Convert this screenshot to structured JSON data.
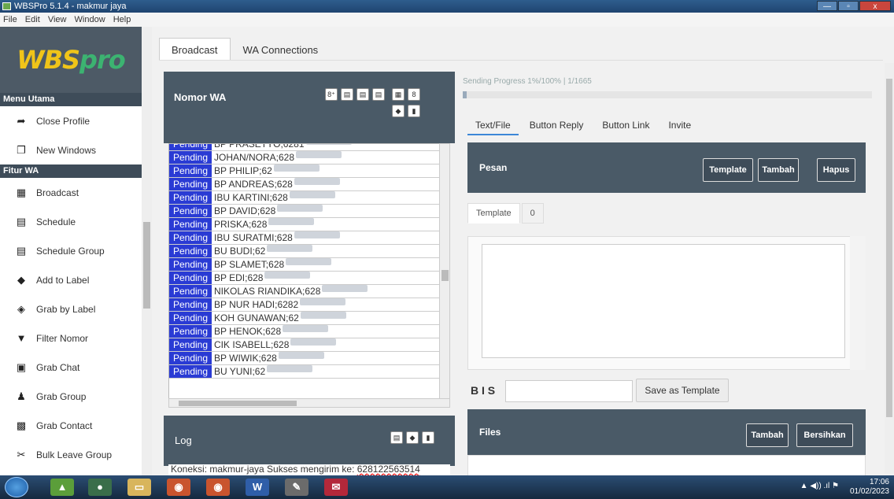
{
  "window": {
    "title": "WBSPro 5.1.4 - makmur jaya",
    "buttons": [
      "—",
      "▫",
      "x"
    ]
  },
  "menu": [
    "File",
    "Edit",
    "View",
    "Window",
    "Help"
  ],
  "logo": {
    "main": "WBS",
    "accent": "pro"
  },
  "sidebar": {
    "section1": "Menu Utama",
    "items1": [
      {
        "label": "Close Profile",
        "icon": "sign-out-icon"
      },
      {
        "label": "New Windows",
        "icon": "windows-icon"
      }
    ],
    "section2": "Fitur WA",
    "items2": [
      {
        "label": "Broadcast",
        "icon": "grid-icon"
      },
      {
        "label": "Schedule",
        "icon": "calendar-icon"
      },
      {
        "label": "Schedule Group",
        "icon": "calendar-group-icon"
      },
      {
        "label": "Add to Label",
        "icon": "tag-icon"
      },
      {
        "label": "Grab by Label",
        "icon": "tags-icon"
      },
      {
        "label": "Filter Nomor",
        "icon": "filter-icon"
      },
      {
        "label": "Grab Chat",
        "icon": "chat-icon"
      },
      {
        "label": "Grab Group",
        "icon": "users-icon"
      },
      {
        "label": "Grab Contact",
        "icon": "contact-card-icon"
      },
      {
        "label": "Bulk Leave Group",
        "icon": "leave-group-icon"
      }
    ]
  },
  "tabs": [
    "Broadcast",
    "WA Connections"
  ],
  "nomor_wa": {
    "title": "Nomor WA"
  },
  "numbers": {
    "status": "Pending",
    "rows": [
      "BP PRASETYO;6281",
      "JOHAN/NORA;628",
      "BP PHILIP;62",
      "BP ANDREAS;628",
      "IBU KARTINI;628",
      "BP DAVID;628",
      "PRISKA;628",
      "IBU SURATMI;628",
      "BU BUDI;62",
      "BP SLAMET;628",
      "BP EDI;628",
      "NIKOLAS RIANDIKA;628",
      "BP NUR HADI;6282",
      "KOH GUNAWAN;62",
      "BP HENOK;628",
      "CIK ISABELL;628",
      "BP WIWIK;628",
      "BU YUNI;62"
    ]
  },
  "log": {
    "title": "Log",
    "text_prefix": "Koneksi: makmur-jaya Sukses mengirim ke: ",
    "text_number": "628122563514"
  },
  "progress": {
    "label": "Sending Progress 1%/100% | 1/1665",
    "percent": 1
  },
  "subtabs": [
    "Text/File",
    "Button Reply",
    "Button Link",
    "Invite"
  ],
  "pesan": {
    "title": "Pesan",
    "btn_template": "Template",
    "btn_tambah": "Tambah",
    "btn_hapus": "Hapus"
  },
  "template_tabs": [
    "Template",
    "0"
  ],
  "format": {
    "label": "B I S",
    "save_template": "Save as Template"
  },
  "files": {
    "title": "Files",
    "btn_tambah": "Tambah",
    "btn_bersihkan": "Bersihkan"
  },
  "clock": {
    "time": "17:06",
    "date": "01/02/2023"
  },
  "colors": {
    "status_blue": "#2a3bd4",
    "panel": "#4a5a67",
    "logo_yellow": "#f0c419",
    "logo_green": "#3cb371"
  }
}
